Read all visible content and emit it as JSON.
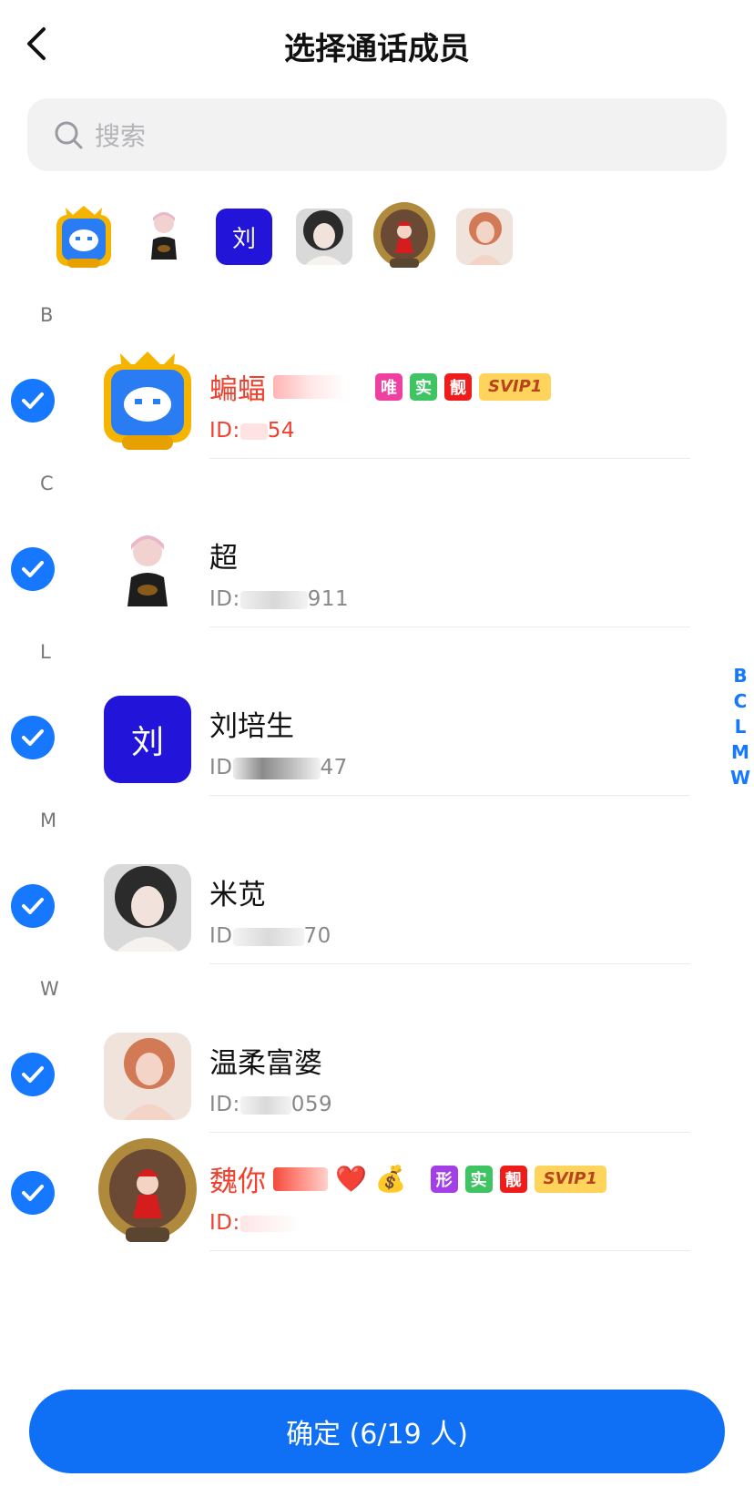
{
  "header": {
    "title": "选择通话成员"
  },
  "search": {
    "placeholder": "搜索"
  },
  "selected_strip": [
    {
      "name": "蝙蝠",
      "kind": "robot-frame-gold"
    },
    {
      "name": "超",
      "kind": "3d-character"
    },
    {
      "name": "刘培生",
      "kind": "letter",
      "letter": "刘"
    },
    {
      "name": "米苋",
      "kind": "photo"
    },
    {
      "name": "魏你",
      "kind": "santa-frame"
    },
    {
      "name": "温柔富婆",
      "kind": "photo"
    }
  ],
  "sections": [
    {
      "letter": "B",
      "contacts": [
        {
          "name": "蝙蝠",
          "id": "ID:",
          "id_suffix": "54",
          "vip": true,
          "badges": [
            "唯",
            "实",
            "靓"
          ],
          "svip": "SVIP1",
          "checked": true
        }
      ]
    },
    {
      "letter": "C",
      "contacts": [
        {
          "name": "超",
          "id": "ID:",
          "id_suffix": "911",
          "vip": false,
          "checked": true
        }
      ]
    },
    {
      "letter": "L",
      "contacts": [
        {
          "name": "刘培生",
          "id": "ID",
          "id_suffix": "47",
          "vip": false,
          "avatar_letter": "刘",
          "checked": true
        }
      ]
    },
    {
      "letter": "M",
      "contacts": [
        {
          "name": "米苋",
          "id": "ID",
          "id_suffix": "70",
          "vip": false,
          "checked": true
        }
      ]
    },
    {
      "letter": "W",
      "contacts": [
        {
          "name": "温柔富婆",
          "id": "ID:",
          "id_suffix": "059",
          "vip": false,
          "checked": true
        },
        {
          "name": "魏你",
          "name_emojis": "❤️ 💰",
          "id": "ID:",
          "id_suffix": "",
          "vip": true,
          "badges": [
            "形",
            "实",
            "靓"
          ],
          "svip": "SVIP1",
          "checked": true
        }
      ]
    }
  ],
  "index_bar": [
    "B",
    "C",
    "L",
    "M",
    "W"
  ],
  "confirm_button": "确定 (6/19 人)",
  "colors": {
    "accent": "#1677ff",
    "vip_red": "#f0402e",
    "badge_pink": "#ef3fa0",
    "badge_green": "#3fc463",
    "badge_red": "#ef1c1c",
    "badge_purple": "#a23fe6",
    "svip_yellow": "#ffd45c"
  }
}
